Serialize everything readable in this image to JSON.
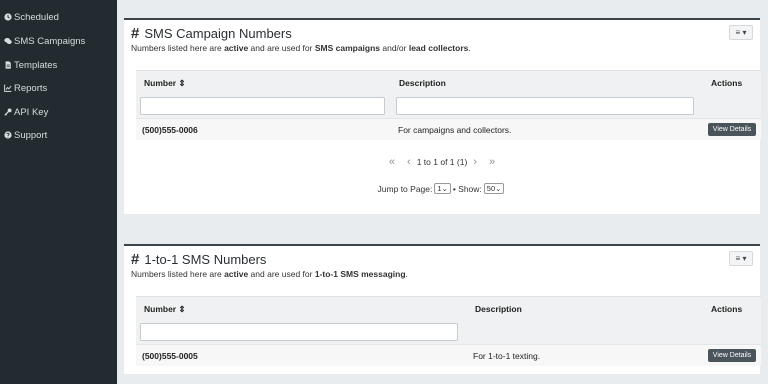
{
  "sidebar": {
    "items": [
      {
        "label": "Scheduled",
        "icon": "clock-icon"
      },
      {
        "label": "SMS Campaigns",
        "icon": "chat-icon"
      },
      {
        "label": "Templates",
        "icon": "file-icon"
      },
      {
        "label": "Reports",
        "icon": "chart-icon"
      },
      {
        "label": "API Key",
        "icon": "key-icon"
      },
      {
        "label": "Support",
        "icon": "question-circle-icon"
      }
    ]
  },
  "campaign_numbers": {
    "title": "SMS Campaign Numbers",
    "subtitle": {
      "p1": "Numbers listed here are ",
      "b1": "active",
      "p2": " and are used for ",
      "b2": "SMS campaigns",
      "p3": " and/or ",
      "b3": "lead collectors",
      "p4": "."
    },
    "columns": {
      "number": "Number ⇕",
      "description": "Description",
      "actions": "Actions"
    },
    "rows": [
      {
        "number": "(500)555-0006",
        "description": "For campaigns and collectors.",
        "action": "View Details"
      }
    ],
    "pager": {
      "first": "«",
      "prev": "‹",
      "info": "1 to 1 of 1 (1)",
      "next": "›",
      "last": "»"
    },
    "jump": {
      "label": "Jump to Page:",
      "page": "1",
      "show_label": "• Show:",
      "show": "50"
    }
  },
  "one_to_one_numbers": {
    "title": "1-to-1 SMS Numbers",
    "subtitle": {
      "p1": "Numbers listed here are ",
      "b1": "active",
      "p2": " and are used for ",
      "b2": "1-to-1 SMS messaging",
      "p3": "."
    },
    "columns": {
      "number": "Number ⇕",
      "description": "Description",
      "actions": "Actions"
    },
    "rows": [
      {
        "number": "(500)555-0005",
        "description": "For 1-to-1 texting.",
        "action": "View Details"
      }
    ]
  },
  "colors": {
    "sidebar_bg": "#212b30",
    "page_bg": "#e9ecef",
    "button_bg": "#4a545b"
  }
}
